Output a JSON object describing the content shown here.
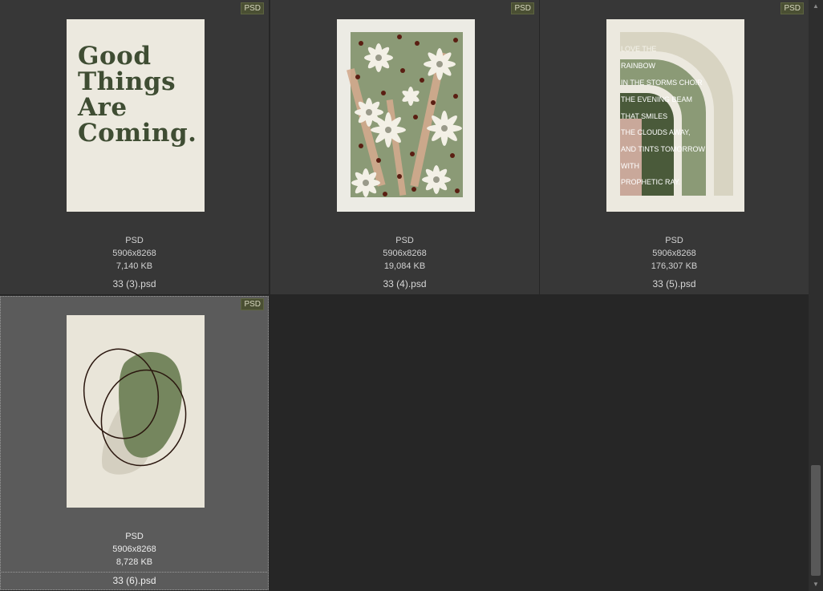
{
  "files": [
    {
      "badge": "PSD",
      "type": "PSD",
      "dimensions": "5906x8268",
      "size": "7,140 KB",
      "name": "33 (3).psd",
      "thumbnail_text": "Good\nThings\nAre\nComing."
    },
    {
      "badge": "PSD",
      "type": "PSD",
      "dimensions": "5906x8268",
      "size": "19,084 KB",
      "name": "33 (4).psd"
    },
    {
      "badge": "PSD",
      "type": "PSD",
      "dimensions": "5906x8268",
      "size": "176,307 KB",
      "name": "33 (5).psd",
      "thumbnail_lines": [
        "LOVE THE",
        "RAINBOW",
        "IN THE STORMS CHOIR",
        "THE EVENING BEAM",
        "THAT SMILES",
        "THE CLOUDS AWAY,",
        "AND TINTS TOMORROW",
        "WITH",
        "PROPHETIC RAY."
      ]
    },
    {
      "badge": "PSD",
      "type": "PSD",
      "dimensions": "5906x8268",
      "size": "8,728 KB",
      "name": "33 (6).psd",
      "selected": true
    }
  ],
  "colors": {
    "background": "#262626",
    "tile": "#373737",
    "tile_selected": "#5b5b5b",
    "badge": "#4a4f33",
    "sage": "#8b9a76",
    "dark_green": "#3f4d33",
    "cream": "#ece9df"
  }
}
